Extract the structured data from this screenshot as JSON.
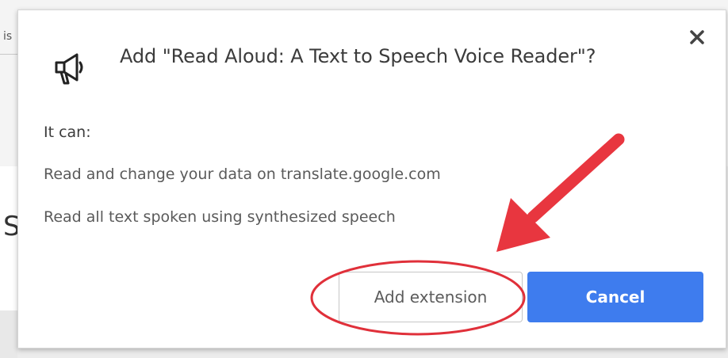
{
  "background": {
    "fragment_top": "is",
    "fragment_mid": "S"
  },
  "dialog": {
    "icon": "megaphone-icon",
    "title": "Add \"Read Aloud: A Text to Speech Voice Reader\"?",
    "close_icon": "close-icon",
    "permissions_heading": "It can:",
    "permissions": [
      "Read and change your data on translate.google.com",
      "Read all text spoken using synthesized speech"
    ],
    "add_button_label": "Add extension",
    "cancel_button_label": "Cancel"
  },
  "annotation": {
    "arrow_color": "#e8363f",
    "circle_color": "#e0303a"
  },
  "colors": {
    "accent": "#3e7cee"
  }
}
